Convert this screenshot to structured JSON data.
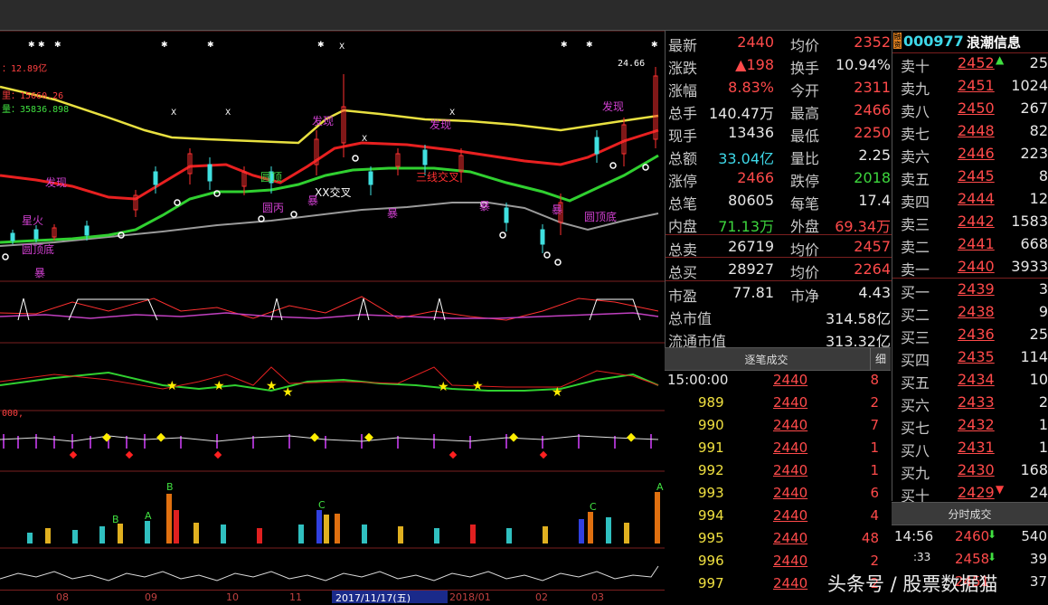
{
  "chart": {
    "price_labels": {
      "top_left": "：12.89亿",
      "line2": "里：15660.26",
      "line3": "量：35836.898",
      "high": "24.66"
    },
    "annotations": [
      "发现",
      "发现",
      "发现",
      "发现",
      "圆顶",
      "圆顶",
      "星火",
      "圆顶底",
      "圆顶底",
      "XX交叉",
      "三线交叉",
      "圆丙",
      "暴",
      "暴",
      "暴",
      "暴",
      "暴"
    ],
    "osc_label": "000,",
    "dates": [
      "08",
      "09",
      "10",
      "11",
      "2017/11/17(五)",
      "2018/01",
      "02",
      "03"
    ]
  },
  "quote": {
    "rows": [
      {
        "l": "最新",
        "v": "2440",
        "vc": "red",
        "l2": "均价",
        "v2": "2352",
        "v2c": "red"
      },
      {
        "l": "涨跌",
        "v": "▲198",
        "vc": "red",
        "l2": "换手",
        "v2": "10.94%",
        "v2c": "white"
      },
      {
        "l": "涨幅",
        "v": "8.83%",
        "vc": "red",
        "l2": "今开",
        "v2": "2311",
        "v2c": "red"
      },
      {
        "l": "总手",
        "v": "140.47万",
        "vc": "white",
        "l2": "最高",
        "v2": "2466",
        "v2c": "red"
      },
      {
        "l": "现手",
        "v": "13436",
        "vc": "white",
        "l2": "最低",
        "v2": "2250",
        "v2c": "red"
      },
      {
        "l": "总额",
        "v": "33.04亿",
        "vc": "cyan",
        "l2": "量比",
        "v2": "2.25",
        "v2c": "white"
      },
      {
        "l": "涨停",
        "v": "2466",
        "vc": "red",
        "l2": "跌停",
        "v2": "2018",
        "v2c": "green"
      },
      {
        "l": "总笔",
        "v": "80605",
        "vc": "white",
        "l2": "每笔",
        "v2": "17.4",
        "v2c": "white"
      },
      {
        "l": "内盘",
        "v": "71.13万",
        "vc": "green",
        "l2": "外盘",
        "v2": "69.34万",
        "v2c": "red"
      }
    ],
    "sum_sell": {
      "l": "总卖",
      "v": "26719",
      "l2": "均价",
      "v2": "2457"
    },
    "sum_buy": {
      "l": "总买",
      "v": "28927",
      "l2": "均价",
      "v2": "2264"
    },
    "pe": {
      "l": "市盈",
      "v": "77.81",
      "l2": "市净",
      "v2": "4.43"
    },
    "total_mv": {
      "l": "总市值",
      "v": "314.58亿"
    },
    "float_mv": {
      "l": "流通市值",
      "v": "313.32亿"
    }
  },
  "ticks": {
    "title": "逐笔成交",
    "detail": "细",
    "rows": [
      {
        "t": "15:00:00",
        "p": "2440",
        "v": "8"
      },
      {
        "t": "989",
        "p": "2440",
        "v": "2"
      },
      {
        "t": "990",
        "p": "2440",
        "v": "7"
      },
      {
        "t": "991",
        "p": "2440",
        "v": "1"
      },
      {
        "t": "992",
        "p": "2440",
        "v": "1"
      },
      {
        "t": "993",
        "p": "2440",
        "v": "6"
      },
      {
        "t": "994",
        "p": "2440",
        "v": "4"
      },
      {
        "t": "995",
        "p": "2440",
        "v": "48"
      },
      {
        "t": "996",
        "p": "2440",
        "v": "2"
      },
      {
        "t": "997",
        "p": "2440",
        "v": "2"
      }
    ]
  },
  "book": {
    "code": "000977",
    "name": "浪潮信息",
    "sell": [
      {
        "n": "卖十",
        "p": "2452",
        "v": "25"
      },
      {
        "n": "卖九",
        "p": "2451",
        "v": "1024"
      },
      {
        "n": "卖八",
        "p": "2450",
        "v": "267"
      },
      {
        "n": "卖七",
        "p": "2448",
        "v": "82"
      },
      {
        "n": "卖六",
        "p": "2446",
        "v": "223"
      },
      {
        "n": "卖五",
        "p": "2445",
        "v": "8"
      },
      {
        "n": "卖四",
        "p": "2444",
        "v": "12"
      },
      {
        "n": "卖三",
        "p": "2442",
        "v": "1583"
      },
      {
        "n": "卖二",
        "p": "2441",
        "v": "668"
      },
      {
        "n": "卖一",
        "p": "2440",
        "v": "3933"
      }
    ],
    "buy": [
      {
        "n": "买一",
        "p": "2439",
        "v": "3"
      },
      {
        "n": "买二",
        "p": "2438",
        "v": "9"
      },
      {
        "n": "买三",
        "p": "2436",
        "v": "25"
      },
      {
        "n": "买四",
        "p": "2435",
        "v": "114"
      },
      {
        "n": "买五",
        "p": "2434",
        "v": "10"
      },
      {
        "n": "买六",
        "p": "2433",
        "v": "2"
      },
      {
        "n": "买七",
        "p": "2432",
        "v": "1"
      },
      {
        "n": "买八",
        "p": "2431",
        "v": "1"
      },
      {
        "n": "买九",
        "p": "2430",
        "v": "168"
      },
      {
        "n": "买十",
        "p": "2429",
        "v": "24"
      }
    ]
  },
  "minute": {
    "title": "分时成交",
    "rows": [
      {
        "t": "14:56",
        "p": "2460",
        "v": "540"
      },
      {
        "t": ":33",
        "p": "2458",
        "v": "39"
      },
      {
        "t": "",
        "p": "2451",
        "v": "37"
      }
    ]
  },
  "watermark": "头条号 / 股票数据猫"
}
